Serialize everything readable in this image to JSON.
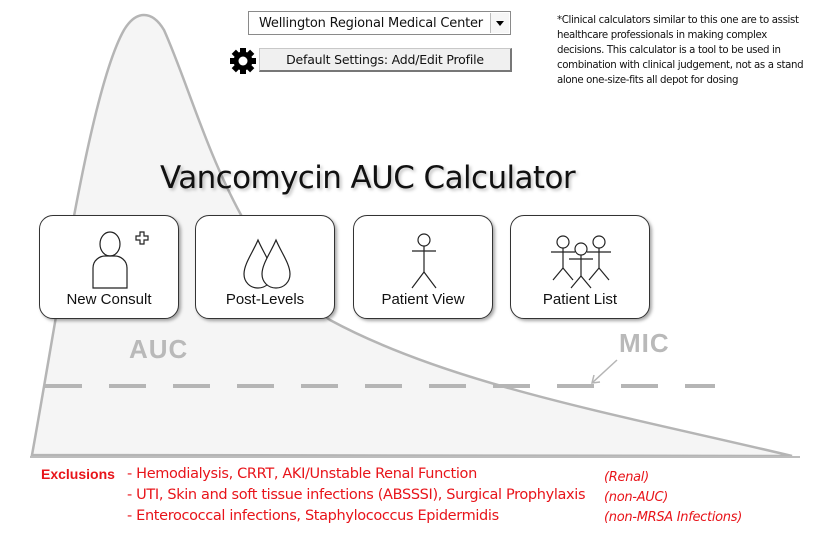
{
  "header": {
    "facility_select": {
      "value": "Wellington Regional Medical Center",
      "icon": "chevron-down-icon"
    },
    "settings_button": {
      "label": "Default Settings: Add/Edit Profile",
      "icon": "gear-icon"
    },
    "disclaimer": "*Clinical calculators similar to this one are to assist healthcare professionals in making complex decisions. This calculator is a tool to be used in combination with clinical judgement, not as a stand alone one-size-fits all depot for dosing"
  },
  "main": {
    "title": "Vancomycin AUC Calculator",
    "tiles": [
      {
        "label": "New Consult",
        "icon": "add-person-icon"
      },
      {
        "label": "Post-Levels",
        "icon": "droplets-icon"
      },
      {
        "label": "Patient View",
        "icon": "stick-figure-icon"
      },
      {
        "label": "Patient List",
        "icon": "group-icon"
      }
    ]
  },
  "background_graphic": {
    "auc_label": "AUC",
    "mic_label": "MIC",
    "curve_color": "#b5b5b5",
    "fill_color": "#f5f5f5"
  },
  "exclusions": {
    "heading": "Exclusions",
    "items": [
      {
        "text": "- Hemodialysis, CRRT, AKI/Unstable Renal Function",
        "note": "(Renal)"
      },
      {
        "text": "- UTI, Skin and soft tissue infections (ABSSSI), Surgical Prophylaxis",
        "note": "(non-AUC)"
      },
      {
        "text": "- Enterococcal infections, Staphylococcus Epidermidis",
        "note": "(non-MRSA Infections)"
      }
    ],
    "color": "#e8141a"
  }
}
